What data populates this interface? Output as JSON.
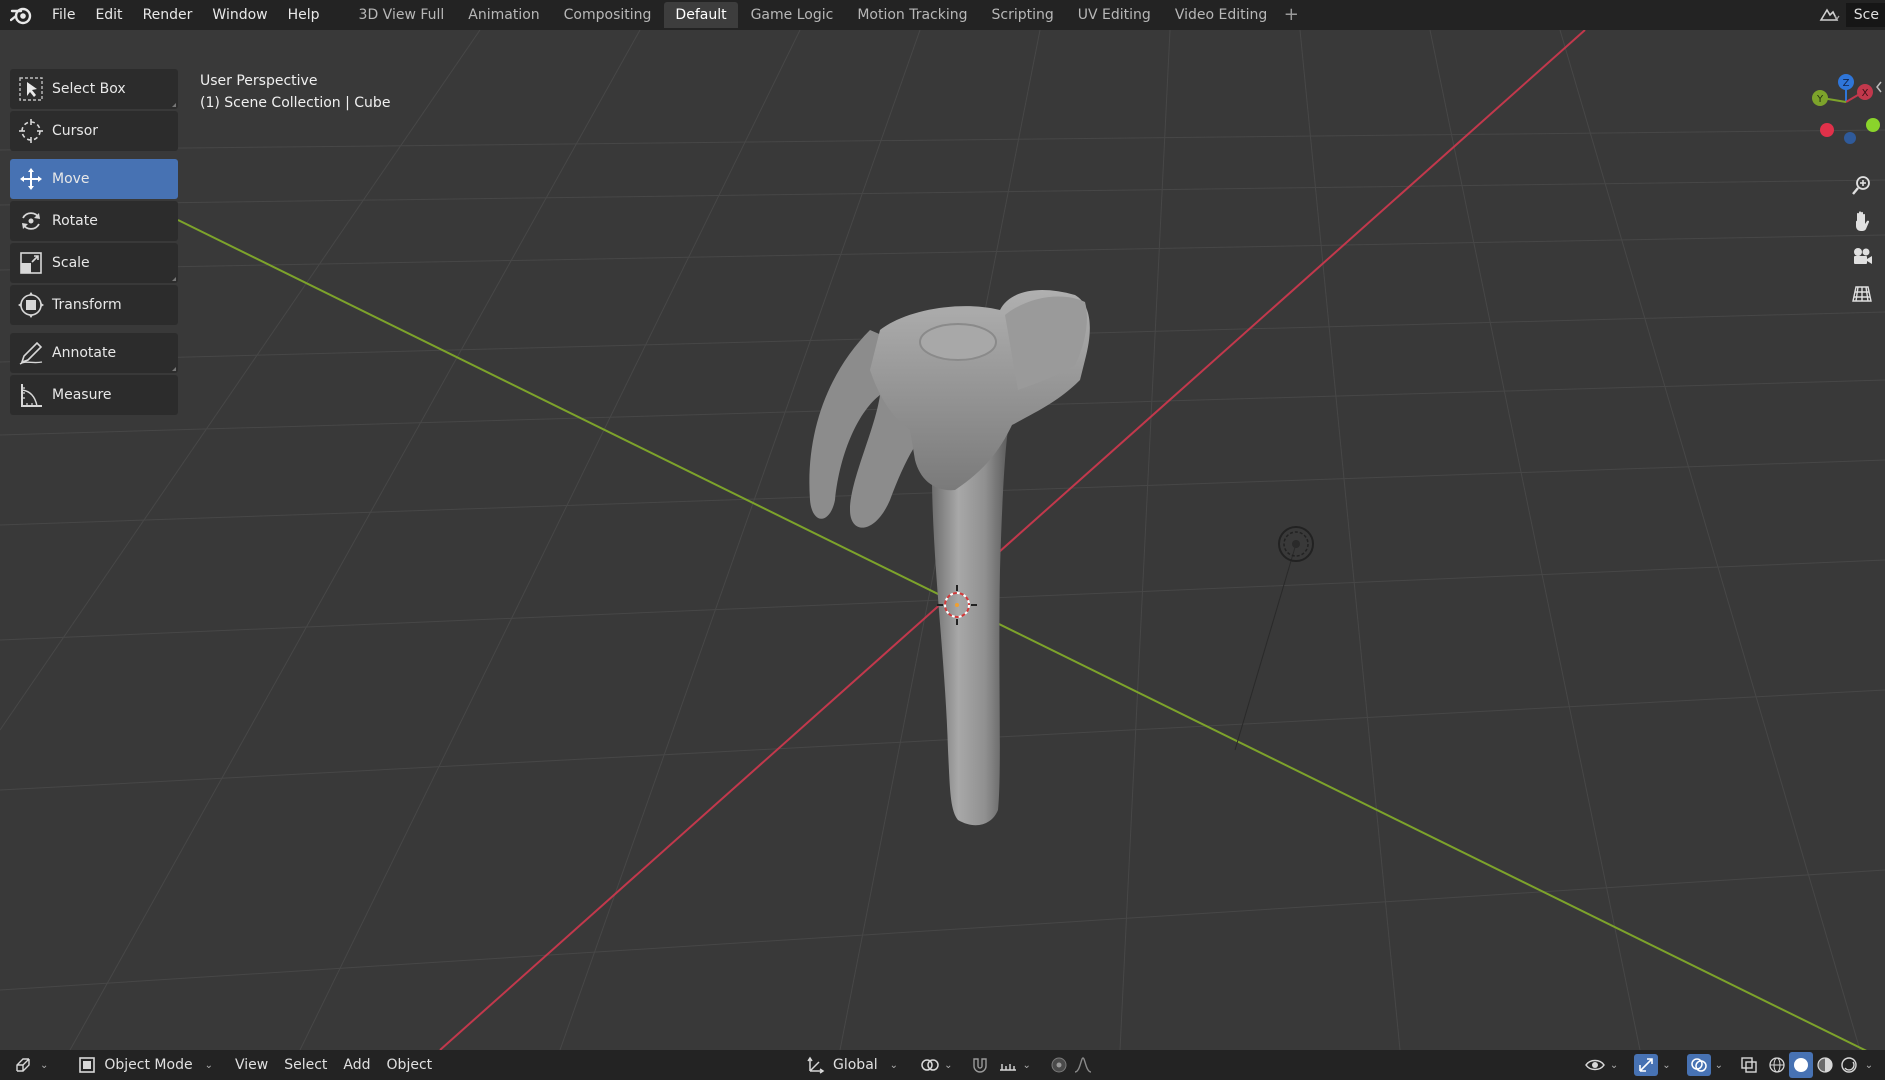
{
  "app": {
    "name": "Blender"
  },
  "menu": {
    "file": "File",
    "edit": "Edit",
    "render": "Render",
    "window": "Window",
    "help": "Help"
  },
  "workspaces": {
    "tabs": [
      {
        "label": "3D View Full"
      },
      {
        "label": "Animation"
      },
      {
        "label": "Compositing"
      },
      {
        "label": "Default",
        "active": true
      },
      {
        "label": "Game Logic"
      },
      {
        "label": "Motion Tracking"
      },
      {
        "label": "Scripting"
      },
      {
        "label": "UV Editing"
      },
      {
        "label": "Video Editing"
      }
    ],
    "add_label": "+"
  },
  "topright": {
    "scene_label": "Sce"
  },
  "tools": {
    "select_box": "Select Box",
    "cursor": "Cursor",
    "move": "Move",
    "rotate": "Rotate",
    "scale": "Scale",
    "transform": "Transform",
    "annotate": "Annotate",
    "measure": "Measure",
    "active": "Move"
  },
  "viewport": {
    "perspective": "User Perspective",
    "collection": "(1) Scene Collection | Cube",
    "gizmo": {
      "x": "X",
      "y": "Y",
      "z": "Z"
    }
  },
  "header": {
    "mode": "Object Mode",
    "view": "View",
    "select": "Select",
    "add": "Add",
    "object": "Object",
    "orientation": "Global"
  },
  "colors": {
    "accent": "#4772b3",
    "axis_x": "#c2384c",
    "axis_y": "#7da32b",
    "axis_z": "#2f76d9",
    "background": "#393939",
    "bar": "#232323"
  }
}
